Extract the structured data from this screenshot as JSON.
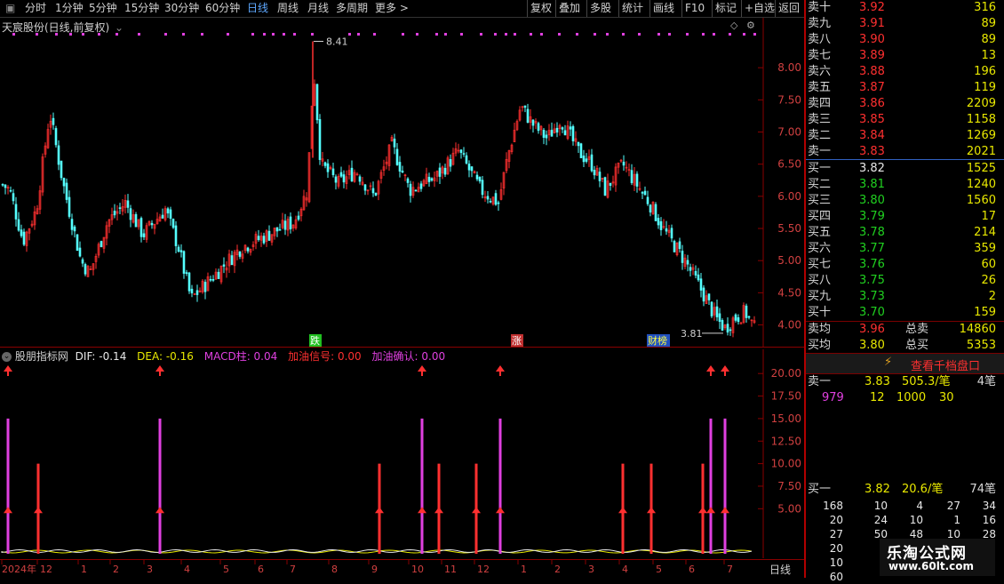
{
  "toolbar": {
    "left": [
      "分时",
      "1分钟",
      "5分钟",
      "15分钟",
      "30分钟",
      "60分钟",
      "日线",
      "周线",
      "月线",
      "多周期",
      "更多 >"
    ],
    "active_index": 6,
    "right": [
      "复权",
      "叠加",
      "多股",
      "统计",
      "画线",
      "F10",
      "标记",
      "+自选",
      "返回"
    ]
  },
  "main_chart": {
    "title": "天宸股份(日线,前复权)",
    "price_axis": [
      "8.00",
      "7.50",
      "7.00",
      "6.50",
      "6.00",
      "5.50",
      "5.00",
      "4.50",
      "4.00"
    ],
    "high_label": "8.41",
    "low_label": "3.81",
    "events": [
      {
        "label": "跌",
        "color": "#20c020",
        "text_color": "#ffffff"
      },
      {
        "label": "涨",
        "color": "#c03030",
        "text_color": "#ffffff"
      },
      {
        "label": "财榜",
        "color": "#2050c0",
        "text_color": "#ffff40"
      }
    ]
  },
  "sub_chart": {
    "name": "股朋指标网",
    "dif_label": "DIF: -0.14",
    "dea_label": "DEA: -0.16",
    "macd_label": "MACD柱: 0.04",
    "signal_label": "加油信号: 0.00",
    "confirm_label": "加油确认: 0.00",
    "axis": [
      "20.00",
      "17.50",
      "15.00",
      "12.50",
      "10.00",
      "7.50",
      "5.00"
    ]
  },
  "time_axis": {
    "labels": [
      "2024年",
      "12",
      "1",
      "2",
      "3",
      "4",
      "5",
      "6",
      "7",
      "8",
      "9",
      "10",
      "11",
      "12",
      "1",
      "2",
      "3",
      "4",
      "5",
      "6",
      "7"
    ],
    "period": "日线"
  },
  "order_book": {
    "sell": [
      {
        "label": "卖十",
        "price": "3.92",
        "vol": "316"
      },
      {
        "label": "卖九",
        "price": "3.91",
        "vol": "89"
      },
      {
        "label": "卖八",
        "price": "3.90",
        "vol": "89"
      },
      {
        "label": "卖七",
        "price": "3.89",
        "vol": "13"
      },
      {
        "label": "卖六",
        "price": "3.88",
        "vol": "196"
      },
      {
        "label": "卖五",
        "price": "3.87",
        "vol": "119"
      },
      {
        "label": "卖四",
        "price": "3.86",
        "vol": "2209"
      },
      {
        "label": "卖三",
        "price": "3.85",
        "vol": "1158"
      },
      {
        "label": "卖二",
        "price": "3.84",
        "vol": "1269"
      },
      {
        "label": "卖一",
        "price": "3.83",
        "vol": "2021"
      }
    ],
    "buy": [
      {
        "label": "买一",
        "price": "3.82",
        "vol": "1525"
      },
      {
        "label": "买二",
        "price": "3.81",
        "vol": "1240"
      },
      {
        "label": "买三",
        "price": "3.80",
        "vol": "1560"
      },
      {
        "label": "买四",
        "price": "3.79",
        "vol": "17"
      },
      {
        "label": "买五",
        "price": "3.78",
        "vol": "214"
      },
      {
        "label": "买六",
        "price": "3.77",
        "vol": "359"
      },
      {
        "label": "买七",
        "price": "3.76",
        "vol": "60"
      },
      {
        "label": "买八",
        "price": "3.75",
        "vol": "26"
      },
      {
        "label": "买九",
        "price": "3.73",
        "vol": "2"
      },
      {
        "label": "买十",
        "price": "3.70",
        "vol": "159"
      }
    ],
    "sell_avg": {
      "label": "卖均",
      "price": "3.96",
      "total_label": "总卖",
      "total": "14860"
    },
    "buy_avg": {
      "label": "买均",
      "price": "3.80",
      "total_label": "总买",
      "total": "5353"
    },
    "view_button": "查看千档盘口",
    "sell1_detail": {
      "label": "卖一",
      "price": "3.83",
      "per": "505.3/笔",
      "count": "4笔"
    },
    "sell1_queue": [
      "979",
      "12",
      "1000",
      "30"
    ],
    "buy1_detail": {
      "label": "买一",
      "price": "3.82",
      "per": "20.6/笔",
      "count": "74笔"
    },
    "buy1_queue": [
      [
        "168",
        "10",
        "4",
        "27",
        "34"
      ],
      [
        "20",
        "24",
        "10",
        "1",
        "16"
      ],
      [
        "27",
        "50",
        "48",
        "10",
        "28"
      ],
      [
        "20",
        "",
        "",
        "",
        ""
      ],
      [
        "10",
        "",
        "",
        "",
        ""
      ],
      [
        "60",
        "",
        "",
        "",
        ""
      ]
    ]
  },
  "watermark": {
    "title": "乐淘公式网",
    "url": "www.60lt.com"
  },
  "colors": {
    "up": "#ff3030",
    "down": "#54ffff",
    "magenta": "#e040e0",
    "axis_red": "#8a0000"
  }
}
